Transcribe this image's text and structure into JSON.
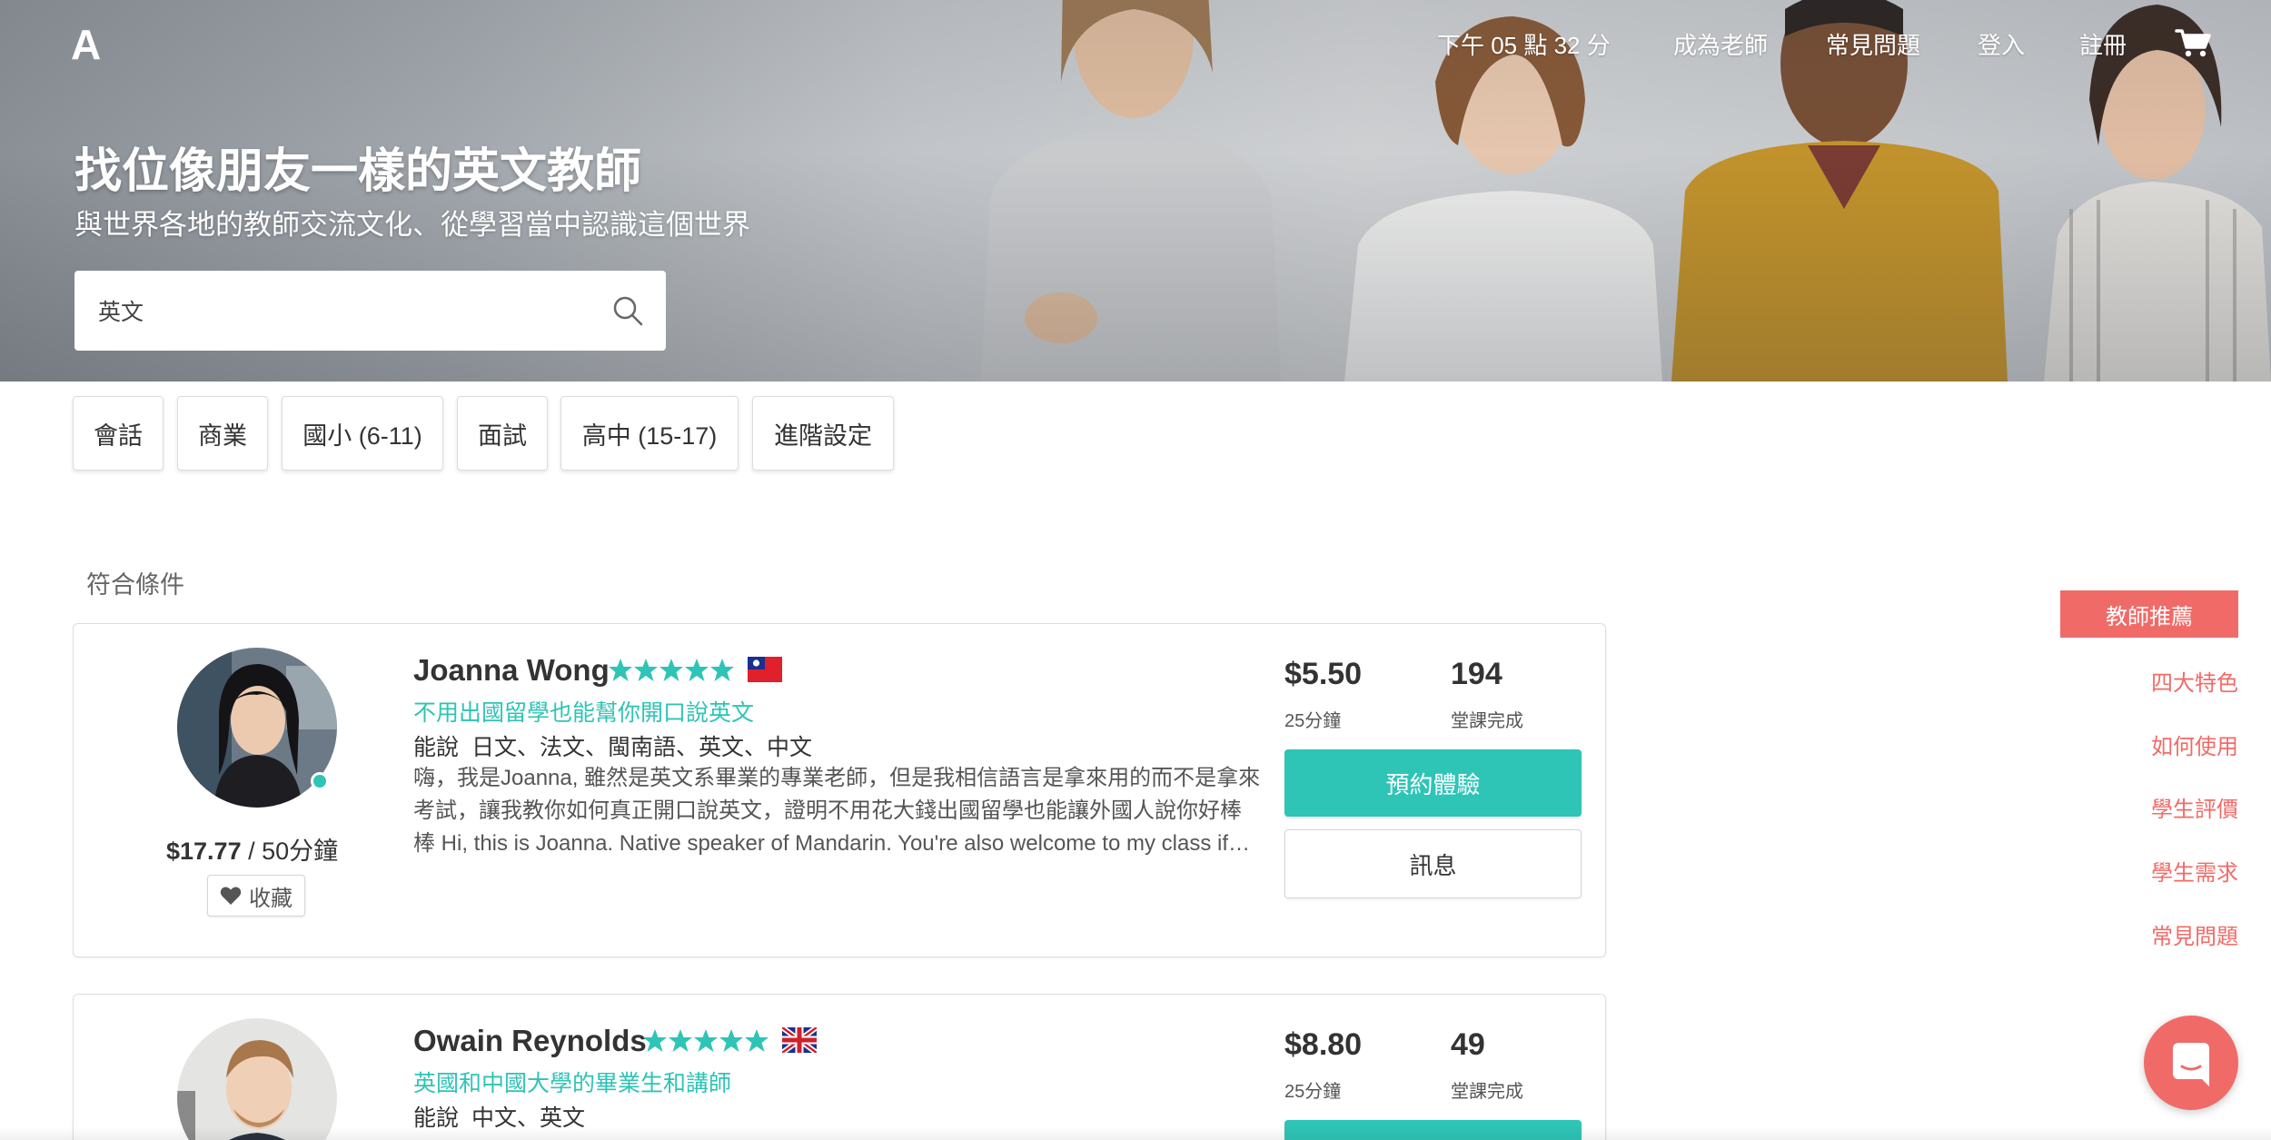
{
  "logo": "A",
  "nav": {
    "time": "下午 05 點 32 分",
    "become_teacher": "成為老師",
    "faq": "常見問題",
    "login": "登入",
    "register": "註冊"
  },
  "hero": {
    "title": "找位像朋友一樣的英文教師",
    "subtitle": "與世界各地的教師交流文化、從學習當中認識這個世界"
  },
  "search": {
    "value": "英文"
  },
  "filters": [
    "會話",
    "商業",
    "國小 (6-11)",
    "面試",
    "高中 (15-17)",
    "進階設定"
  ],
  "results_label": "符合條件",
  "teachers": [
    {
      "name": "Joanna Wong",
      "rating": 5,
      "flag": "taiwan-flag",
      "tagline": "不用出國留學也能幫你開口說英文",
      "langs_label": "能說",
      "langs": "日文、法文、閩南語、英文、中文",
      "description": "嗨，我是Joanna, 雖然是英文系畢業的專業老師，但是我相信語言是拿來用的而不是拿來考試，讓我教你如何真正開口說英文，證明不用花大錢出國留學也能讓外國人說你好棒棒 Hi, this is Joanna. Native speaker of Mandarin. You're also welcome to my class if…",
      "price_strong": "$17.77",
      "price_rest": " / 50分鐘",
      "favorite": "收藏",
      "trial_price": "$5.50",
      "trial_duration": "25分鐘",
      "lessons": "194",
      "lessons_label": "堂課完成",
      "book": "預約體驗",
      "message": "訊息"
    },
    {
      "name": "Owain Reynolds",
      "rating": 5,
      "flag": "uk-flag",
      "tagline": "英國和中國大學的畢業生和講師",
      "langs_label": "能說",
      "langs": "中文、英文",
      "trial_price": "$8.80",
      "trial_duration": "25分鐘",
      "lessons": "49",
      "lessons_label": "堂課完成"
    }
  ],
  "side_nav": {
    "active": "教師推薦",
    "links": [
      "四大特色",
      "如何使用",
      "學生評價",
      "學生需求",
      "常見問題"
    ]
  },
  "colors": {
    "teal": "#2ec4b6",
    "coral": "#f06b67",
    "text": "#333333"
  }
}
